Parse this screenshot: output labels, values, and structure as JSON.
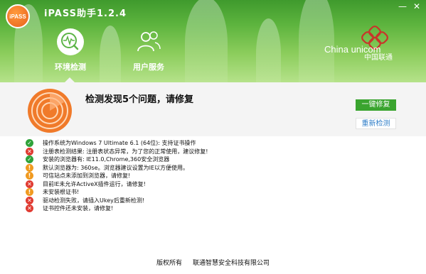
{
  "window": {
    "logo_text": "iPASS",
    "title": "iPASS助手1.2.4",
    "minimize_label": "—",
    "close_label": "✕"
  },
  "tabs": [
    {
      "label": "环境检测",
      "icon": "environment-check-icon",
      "active": true
    },
    {
      "label": "用户服务",
      "icon": "user-service-icon",
      "active": false
    }
  ],
  "brand": {
    "en": "China unicom",
    "cn": "中国联通"
  },
  "summary": {
    "headline": "检测发现5个问题，请修复",
    "fix_button": "一键修复",
    "recheck_button": "重新检测"
  },
  "results": [
    {
      "status": "ok",
      "text": "操作系统为Windows 7 Ultimate 6.1 (64位): 支持证书操作"
    },
    {
      "status": "error",
      "text": "注册表检测结果: 注册表状态异常，为了您的正常使用，建议修复!"
    },
    {
      "status": "ok",
      "text": "安装的浏览器有: IE11.0,Chrome,360安全浏览器"
    },
    {
      "status": "warn",
      "text": "默认浏览器为: 360se。浏览器建议设置为IE以方便使用。"
    },
    {
      "status": "warn",
      "text": "可信站点未添加到浏览器，请修复!"
    },
    {
      "status": "error",
      "text": "目前IE未允许ActiveX插件运行，请修复!"
    },
    {
      "status": "warn",
      "text": "未安装根证书!"
    },
    {
      "status": "error",
      "text": "驱动检测失败，请插入Ukey后重新检测!"
    },
    {
      "status": "error",
      "text": "证书控件还未安装，请修复!"
    }
  ],
  "footer": {
    "copyright": "版权所有",
    "company": "联通智慧安全科技有限公司"
  },
  "colors": {
    "accent_green": "#3aa42f",
    "ok": "#2fa23a",
    "error": "#e03b32",
    "warn": "#f09a20",
    "link": "#2f7ec8"
  }
}
